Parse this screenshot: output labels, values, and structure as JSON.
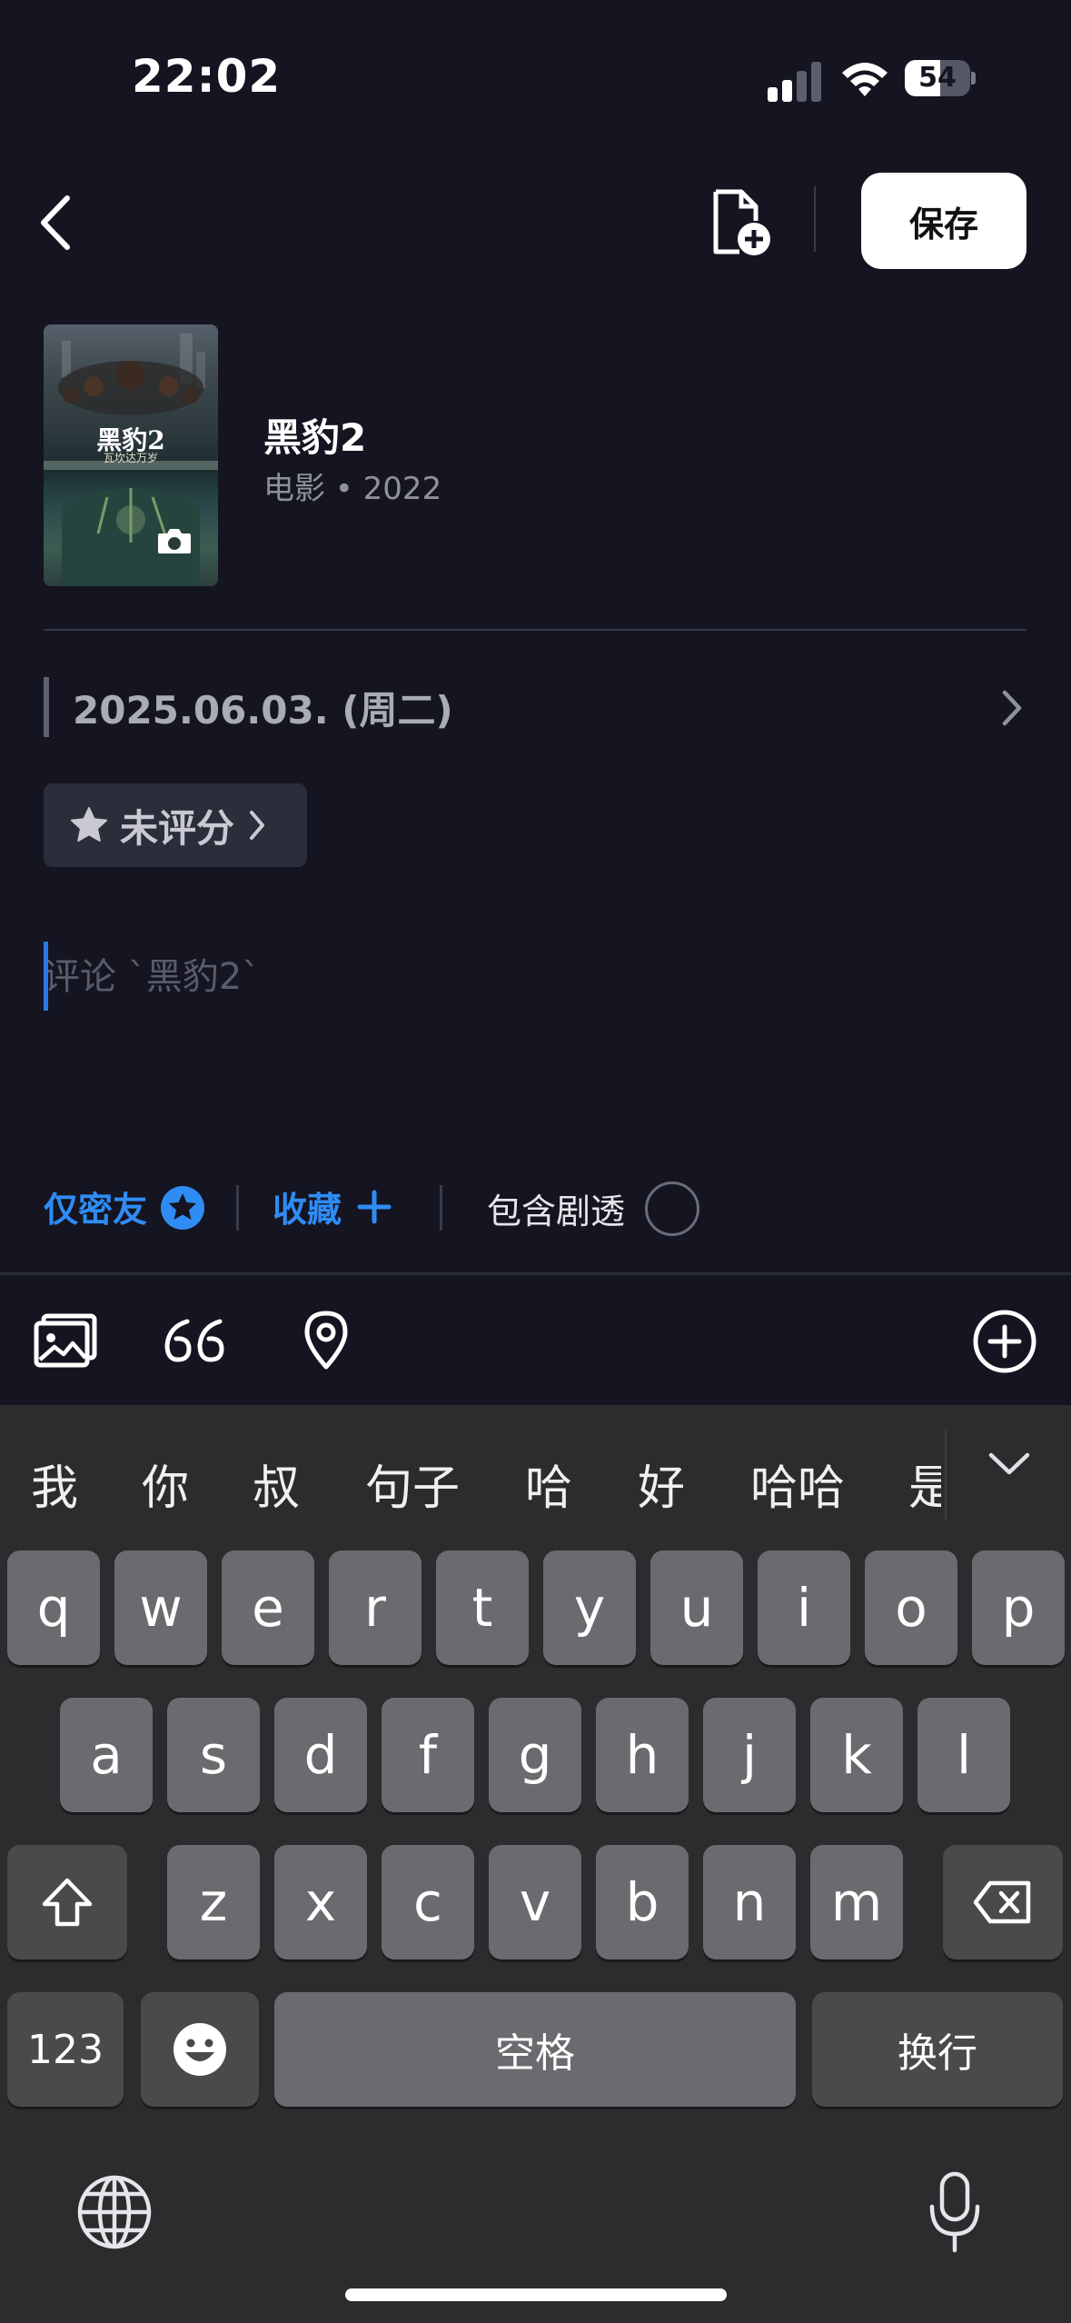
{
  "status_bar": {
    "time": "22:02",
    "battery": "54",
    "battery_level": 0.54
  },
  "header": {
    "save_label": "保存"
  },
  "movie": {
    "title": "黑豹2",
    "meta": "电影 • 2022",
    "poster_title": "黑豹2",
    "poster_subtitle": "瓦坎达万岁"
  },
  "date": {
    "text": "2025.06.03. (周二)"
  },
  "rating": {
    "label": "未评分"
  },
  "comment": {
    "placeholder": "评论 `黑豹2`",
    "value": ""
  },
  "options": {
    "friends_only": "仅密友",
    "collect": "收藏",
    "spoiler": "包含剧透"
  },
  "keyboard": {
    "candidates": [
      "我",
      "你",
      "叔",
      "句子",
      "哈",
      "好",
      "哈哈",
      "是"
    ],
    "row1": [
      "q",
      "w",
      "e",
      "r",
      "t",
      "y",
      "u",
      "i",
      "o",
      "p"
    ],
    "row2": [
      "a",
      "s",
      "d",
      "f",
      "g",
      "h",
      "j",
      "k",
      "l"
    ],
    "row3": [
      "z",
      "x",
      "c",
      "v",
      "b",
      "n",
      "m"
    ],
    "numbers_label": "123",
    "space_label": "空格",
    "return_label": "换行"
  },
  "colors": {
    "background": "#141521",
    "accent": "#2f8cf5",
    "keyboard": "#2c2c2e"
  }
}
